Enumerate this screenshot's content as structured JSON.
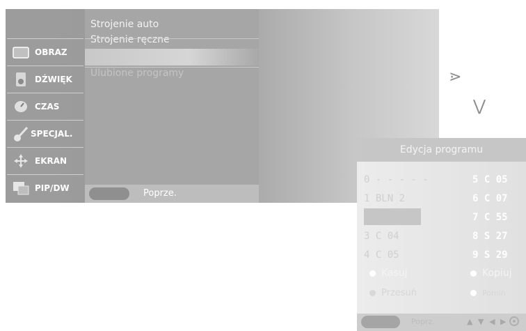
{
  "sidebar": {
    "items": [
      {
        "label": "OBRAZ",
        "icon": "picture-icon"
      },
      {
        "label": "DŹWIĘK",
        "icon": "speaker-icon"
      },
      {
        "label": "CZAS",
        "icon": "clock-icon"
      },
      {
        "label": "SPECJAL.",
        "icon": "key-icon"
      },
      {
        "label": "EKRAN",
        "icon": "move-icon"
      },
      {
        "label": "PIP/DW",
        "icon": "pip-icon"
      }
    ]
  },
  "menu": {
    "items": [
      "Strojenie auto",
      "Strojenie ręczne",
      "",
      "Ulubione programy"
    ],
    "footer_label": "Poprze."
  },
  "arrows": {
    "right": "⋗",
    "down": "⋁"
  },
  "edit": {
    "title": "Edycja programu",
    "left_rows": [
      "0 - - - - -",
      "1 BLN 2",
      "",
      "3  C  04",
      "4  C  05"
    ],
    "right_rows": [
      "5  C  05",
      "6  C  07",
      "7  C  55",
      "8  S  27",
      "9  S  29"
    ],
    "opt_delete": "Kasuj",
    "opt_copy": "Kopiuj",
    "opt_move": "Przesuń",
    "opt_skip": "Pomiń",
    "footer_label": "Poprz."
  }
}
